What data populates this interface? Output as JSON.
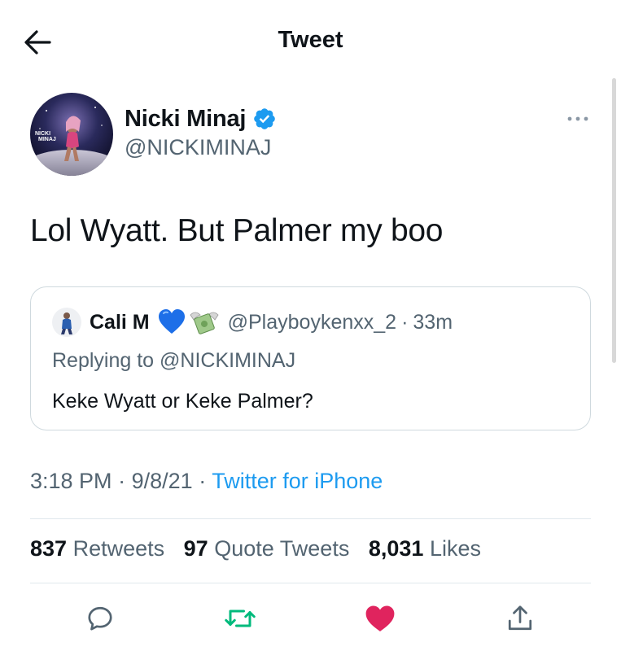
{
  "header": {
    "title": "Tweet"
  },
  "tweet": {
    "author_name": "Nicki Minaj",
    "handle": "@NICKIMINAJ",
    "avatar_text": "NICKI MINAJ",
    "text": "Lol Wyatt. But Palmer my boo",
    "time": "3:18 PM",
    "separator": "·",
    "date": "9/8/21",
    "source": "Twitter for iPhone"
  },
  "quoted": {
    "name": "Cali M",
    "handle": "@Playboykenxx_2",
    "separator": "·",
    "time": "33m",
    "reply_prefix": "Replying to",
    "reply_handle": "@NICKIMINAJ",
    "text": "Keke Wyatt or Keke Palmer?"
  },
  "stats": {
    "retweets_count": "837",
    "retweets_label": "Retweets",
    "quotes_count": "97",
    "quotes_label": "Quote Tweets",
    "likes_count": "8,031",
    "likes_label": "Likes"
  },
  "icons": {
    "back": "arrow-left-icon",
    "verified": "verified-badge-icon",
    "more": "more-horizontal-icon",
    "reply": "reply-icon",
    "retweet": "retweet-icon",
    "like": "heart-icon",
    "share": "share-icon"
  },
  "colors": {
    "accent": "#1d9bf0",
    "retweet": "#00ba7c",
    "like": "#f91880",
    "secondary_text": "#536471",
    "text": "#0f1419",
    "border": "#cfd9de"
  }
}
